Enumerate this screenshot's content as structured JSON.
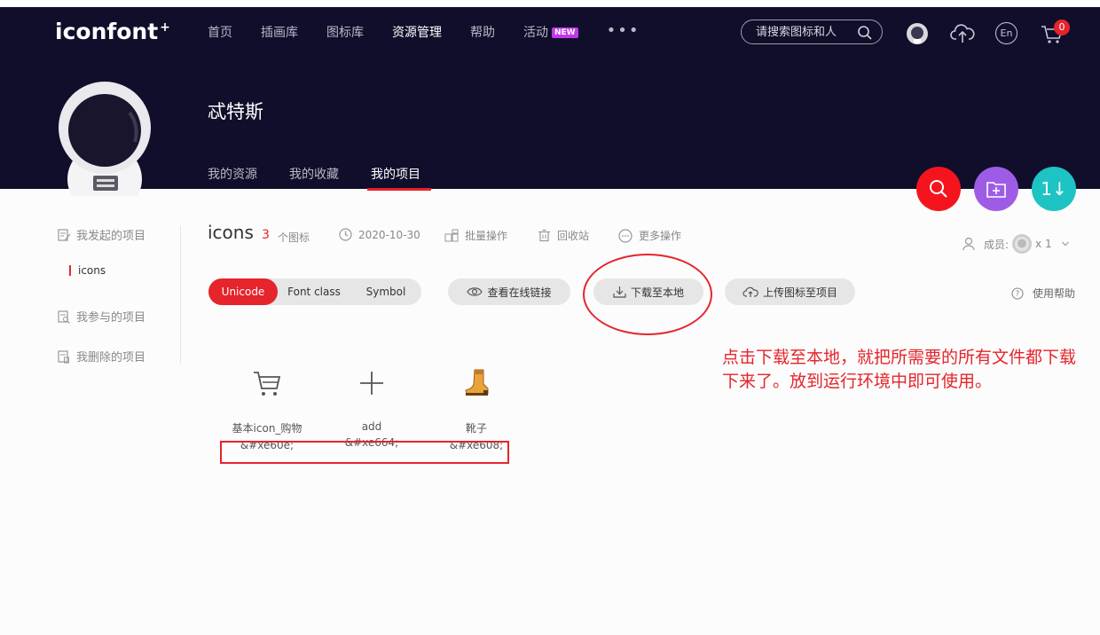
{
  "header": {
    "logo": "iconfont",
    "logo_mark": "+",
    "nav": [
      {
        "label": "首页",
        "active": false
      },
      {
        "label": "插画库",
        "active": false
      },
      {
        "label": "图标库",
        "active": false
      },
      {
        "label": "资源管理",
        "active": true
      },
      {
        "label": "帮助",
        "active": false
      },
      {
        "label": "活动",
        "active": false,
        "badge": "NEW"
      }
    ],
    "more": "•••",
    "search_placeholder": "请搜索图标和人",
    "cart_count": "0",
    "lang": "En"
  },
  "profile": {
    "name": "忒特斯",
    "tabs": [
      {
        "label": "我的资源",
        "active": false
      },
      {
        "label": "我的收藏",
        "active": false
      },
      {
        "label": "我的项目",
        "active": true
      }
    ]
  },
  "fabs": {
    "sort_label": "1↓"
  },
  "sidebar": {
    "items": [
      {
        "label": "我发起的项目"
      },
      {
        "label": "我参与的项目"
      },
      {
        "label": "我删除的项目"
      }
    ],
    "sub_item": "icons"
  },
  "project": {
    "title": "icons",
    "count": "3",
    "count_label": "个图标",
    "date": "2020-10-30",
    "batch": "批量操作",
    "trash": "回收站",
    "more": "更多操作",
    "members_label": "成员:",
    "members_count": "x 1"
  },
  "toolbar": {
    "tabs": [
      "Unicode",
      "Font class",
      "Symbol"
    ],
    "active_tab": "Unicode",
    "view_online": "查看在线链接",
    "download": "下载至本地",
    "upload": "上传图标至项目",
    "help": "使用帮助"
  },
  "annotation": "点击下载至本地，就把所需要的所有文件都下载下来了。放到运行环境中即可使用。",
  "icons": [
    {
      "name": "基本icon_购物",
      "code": "&#xe60e;",
      "icon": "cart-icon"
    },
    {
      "name": "add",
      "code": "&#xe664;",
      "icon": "plus-icon"
    },
    {
      "name": "靴子",
      "code": "&#xe608;",
      "icon": "boot-icon"
    }
  ],
  "colors": {
    "header_bg": "#110e2b",
    "accent_red": "#e5242b",
    "fab_red": "#f5141e",
    "fab_purple": "#9e5ce6",
    "fab_teal": "#1ec3c4"
  }
}
